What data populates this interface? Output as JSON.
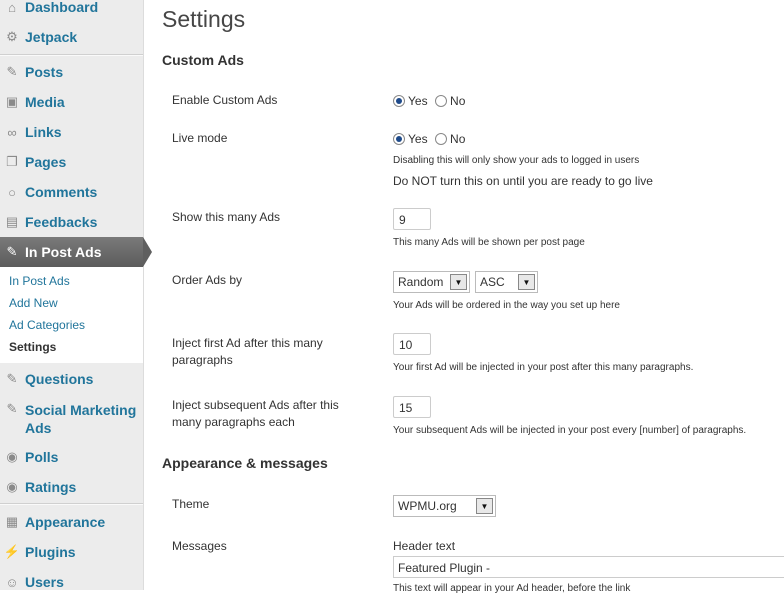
{
  "sidebar": {
    "items": [
      {
        "label": "Dashboard",
        "icon": "home-icon"
      },
      {
        "label": "Jetpack",
        "icon": "jetpack-icon"
      },
      {
        "label": "Posts",
        "icon": "pin-icon"
      },
      {
        "label": "Media",
        "icon": "media-icon"
      },
      {
        "label": "Links",
        "icon": "link-icon"
      },
      {
        "label": "Pages",
        "icon": "pages-icon"
      },
      {
        "label": "Comments",
        "icon": "comment-icon"
      },
      {
        "label": "Feedbacks",
        "icon": "feedback-icon"
      },
      {
        "label": "In Post Ads",
        "icon": "pin-icon"
      },
      {
        "label": "Questions",
        "icon": "pin-icon"
      },
      {
        "label": "Social Marketing Ads",
        "icon": "pin-icon"
      },
      {
        "label": "Polls",
        "icon": "poll-icon"
      },
      {
        "label": "Ratings",
        "icon": "rating-icon"
      },
      {
        "label": "Appearance",
        "icon": "appearance-icon"
      },
      {
        "label": "Plugins",
        "icon": "plugin-icon"
      },
      {
        "label": "Users",
        "icon": "users-icon"
      }
    ],
    "submenu": [
      "In Post Ads",
      "Add New",
      "Ad Categories",
      "Settings"
    ]
  },
  "page": {
    "title": "Settings",
    "section_custom_ads": "Custom Ads",
    "section_appearance": "Appearance & messages"
  },
  "fields": {
    "enable_custom_ads": {
      "label": "Enable Custom Ads",
      "yes": "Yes",
      "no": "No",
      "selected": "Yes"
    },
    "live_mode": {
      "label": "Live mode",
      "yes": "Yes",
      "no": "No",
      "selected": "Yes",
      "desc": "Disabling this will only show your ads to logged in users",
      "note": "Do NOT turn this on until you are ready to go live"
    },
    "show_many": {
      "label": "Show this many Ads",
      "value": "9",
      "desc": "This many Ads will be shown per post page"
    },
    "order_by": {
      "label": "Order Ads by",
      "value": "Random",
      "direction": "ASC",
      "desc": "Your Ads will be ordered in the way you set up here"
    },
    "inject_first": {
      "label": "Inject first Ad after this many paragraphs",
      "value": "10",
      "desc": "Your first Ad will be injected in your post after this many paragraphs."
    },
    "inject_subsequent": {
      "label": "Inject subsequent Ads after this many paragraphs each",
      "value": "15",
      "desc": "Your subsequent Ads will be injected in your post every [number] of paragraphs."
    },
    "theme": {
      "label": "Theme",
      "value": "WPMU.org"
    },
    "messages": {
      "label": "Messages",
      "header_label": "Header text",
      "header_value": "Featured Plugin -",
      "header_desc": "This text will appear in your Ad header, before the link"
    }
  }
}
